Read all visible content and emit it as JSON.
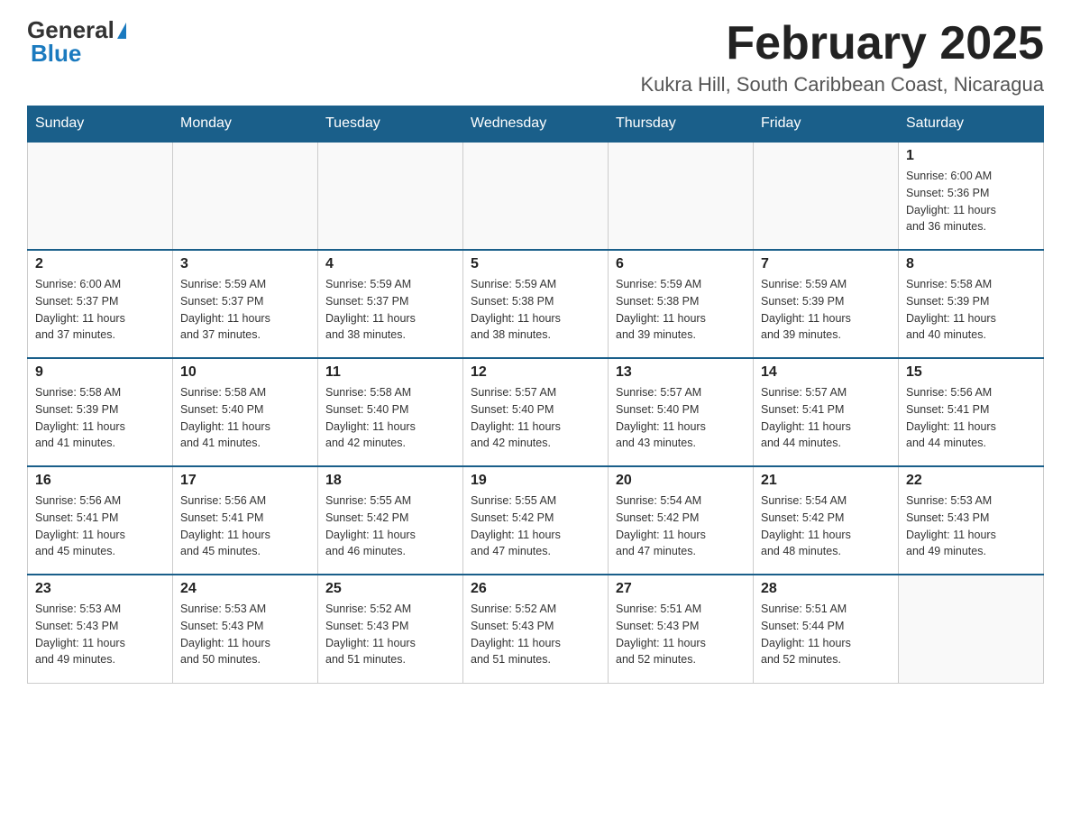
{
  "header": {
    "logo_general": "General",
    "logo_blue": "Blue",
    "title": "February 2025",
    "subtitle": "Kukra Hill, South Caribbean Coast, Nicaragua"
  },
  "calendar": {
    "days_of_week": [
      "Sunday",
      "Monday",
      "Tuesday",
      "Wednesday",
      "Thursday",
      "Friday",
      "Saturday"
    ],
    "weeks": [
      {
        "days": [
          {
            "number": "",
            "info": ""
          },
          {
            "number": "",
            "info": ""
          },
          {
            "number": "",
            "info": ""
          },
          {
            "number": "",
            "info": ""
          },
          {
            "number": "",
            "info": ""
          },
          {
            "number": "",
            "info": ""
          },
          {
            "number": "1",
            "info": "Sunrise: 6:00 AM\nSunset: 5:36 PM\nDaylight: 11 hours\nand 36 minutes."
          }
        ]
      },
      {
        "days": [
          {
            "number": "2",
            "info": "Sunrise: 6:00 AM\nSunset: 5:37 PM\nDaylight: 11 hours\nand 37 minutes."
          },
          {
            "number": "3",
            "info": "Sunrise: 5:59 AM\nSunset: 5:37 PM\nDaylight: 11 hours\nand 37 minutes."
          },
          {
            "number": "4",
            "info": "Sunrise: 5:59 AM\nSunset: 5:37 PM\nDaylight: 11 hours\nand 38 minutes."
          },
          {
            "number": "5",
            "info": "Sunrise: 5:59 AM\nSunset: 5:38 PM\nDaylight: 11 hours\nand 38 minutes."
          },
          {
            "number": "6",
            "info": "Sunrise: 5:59 AM\nSunset: 5:38 PM\nDaylight: 11 hours\nand 39 minutes."
          },
          {
            "number": "7",
            "info": "Sunrise: 5:59 AM\nSunset: 5:39 PM\nDaylight: 11 hours\nand 39 minutes."
          },
          {
            "number": "8",
            "info": "Sunrise: 5:58 AM\nSunset: 5:39 PM\nDaylight: 11 hours\nand 40 minutes."
          }
        ]
      },
      {
        "days": [
          {
            "number": "9",
            "info": "Sunrise: 5:58 AM\nSunset: 5:39 PM\nDaylight: 11 hours\nand 41 minutes."
          },
          {
            "number": "10",
            "info": "Sunrise: 5:58 AM\nSunset: 5:40 PM\nDaylight: 11 hours\nand 41 minutes."
          },
          {
            "number": "11",
            "info": "Sunrise: 5:58 AM\nSunset: 5:40 PM\nDaylight: 11 hours\nand 42 minutes."
          },
          {
            "number": "12",
            "info": "Sunrise: 5:57 AM\nSunset: 5:40 PM\nDaylight: 11 hours\nand 42 minutes."
          },
          {
            "number": "13",
            "info": "Sunrise: 5:57 AM\nSunset: 5:40 PM\nDaylight: 11 hours\nand 43 minutes."
          },
          {
            "number": "14",
            "info": "Sunrise: 5:57 AM\nSunset: 5:41 PM\nDaylight: 11 hours\nand 44 minutes."
          },
          {
            "number": "15",
            "info": "Sunrise: 5:56 AM\nSunset: 5:41 PM\nDaylight: 11 hours\nand 44 minutes."
          }
        ]
      },
      {
        "days": [
          {
            "number": "16",
            "info": "Sunrise: 5:56 AM\nSunset: 5:41 PM\nDaylight: 11 hours\nand 45 minutes."
          },
          {
            "number": "17",
            "info": "Sunrise: 5:56 AM\nSunset: 5:41 PM\nDaylight: 11 hours\nand 45 minutes."
          },
          {
            "number": "18",
            "info": "Sunrise: 5:55 AM\nSunset: 5:42 PM\nDaylight: 11 hours\nand 46 minutes."
          },
          {
            "number": "19",
            "info": "Sunrise: 5:55 AM\nSunset: 5:42 PM\nDaylight: 11 hours\nand 47 minutes."
          },
          {
            "number": "20",
            "info": "Sunrise: 5:54 AM\nSunset: 5:42 PM\nDaylight: 11 hours\nand 47 minutes."
          },
          {
            "number": "21",
            "info": "Sunrise: 5:54 AM\nSunset: 5:42 PM\nDaylight: 11 hours\nand 48 minutes."
          },
          {
            "number": "22",
            "info": "Sunrise: 5:53 AM\nSunset: 5:43 PM\nDaylight: 11 hours\nand 49 minutes."
          }
        ]
      },
      {
        "days": [
          {
            "number": "23",
            "info": "Sunrise: 5:53 AM\nSunset: 5:43 PM\nDaylight: 11 hours\nand 49 minutes."
          },
          {
            "number": "24",
            "info": "Sunrise: 5:53 AM\nSunset: 5:43 PM\nDaylight: 11 hours\nand 50 minutes."
          },
          {
            "number": "25",
            "info": "Sunrise: 5:52 AM\nSunset: 5:43 PM\nDaylight: 11 hours\nand 51 minutes."
          },
          {
            "number": "26",
            "info": "Sunrise: 5:52 AM\nSunset: 5:43 PM\nDaylight: 11 hours\nand 51 minutes."
          },
          {
            "number": "27",
            "info": "Sunrise: 5:51 AM\nSunset: 5:43 PM\nDaylight: 11 hours\nand 52 minutes."
          },
          {
            "number": "28",
            "info": "Sunrise: 5:51 AM\nSunset: 5:44 PM\nDaylight: 11 hours\nand 52 minutes."
          },
          {
            "number": "",
            "info": ""
          }
        ]
      }
    ]
  }
}
